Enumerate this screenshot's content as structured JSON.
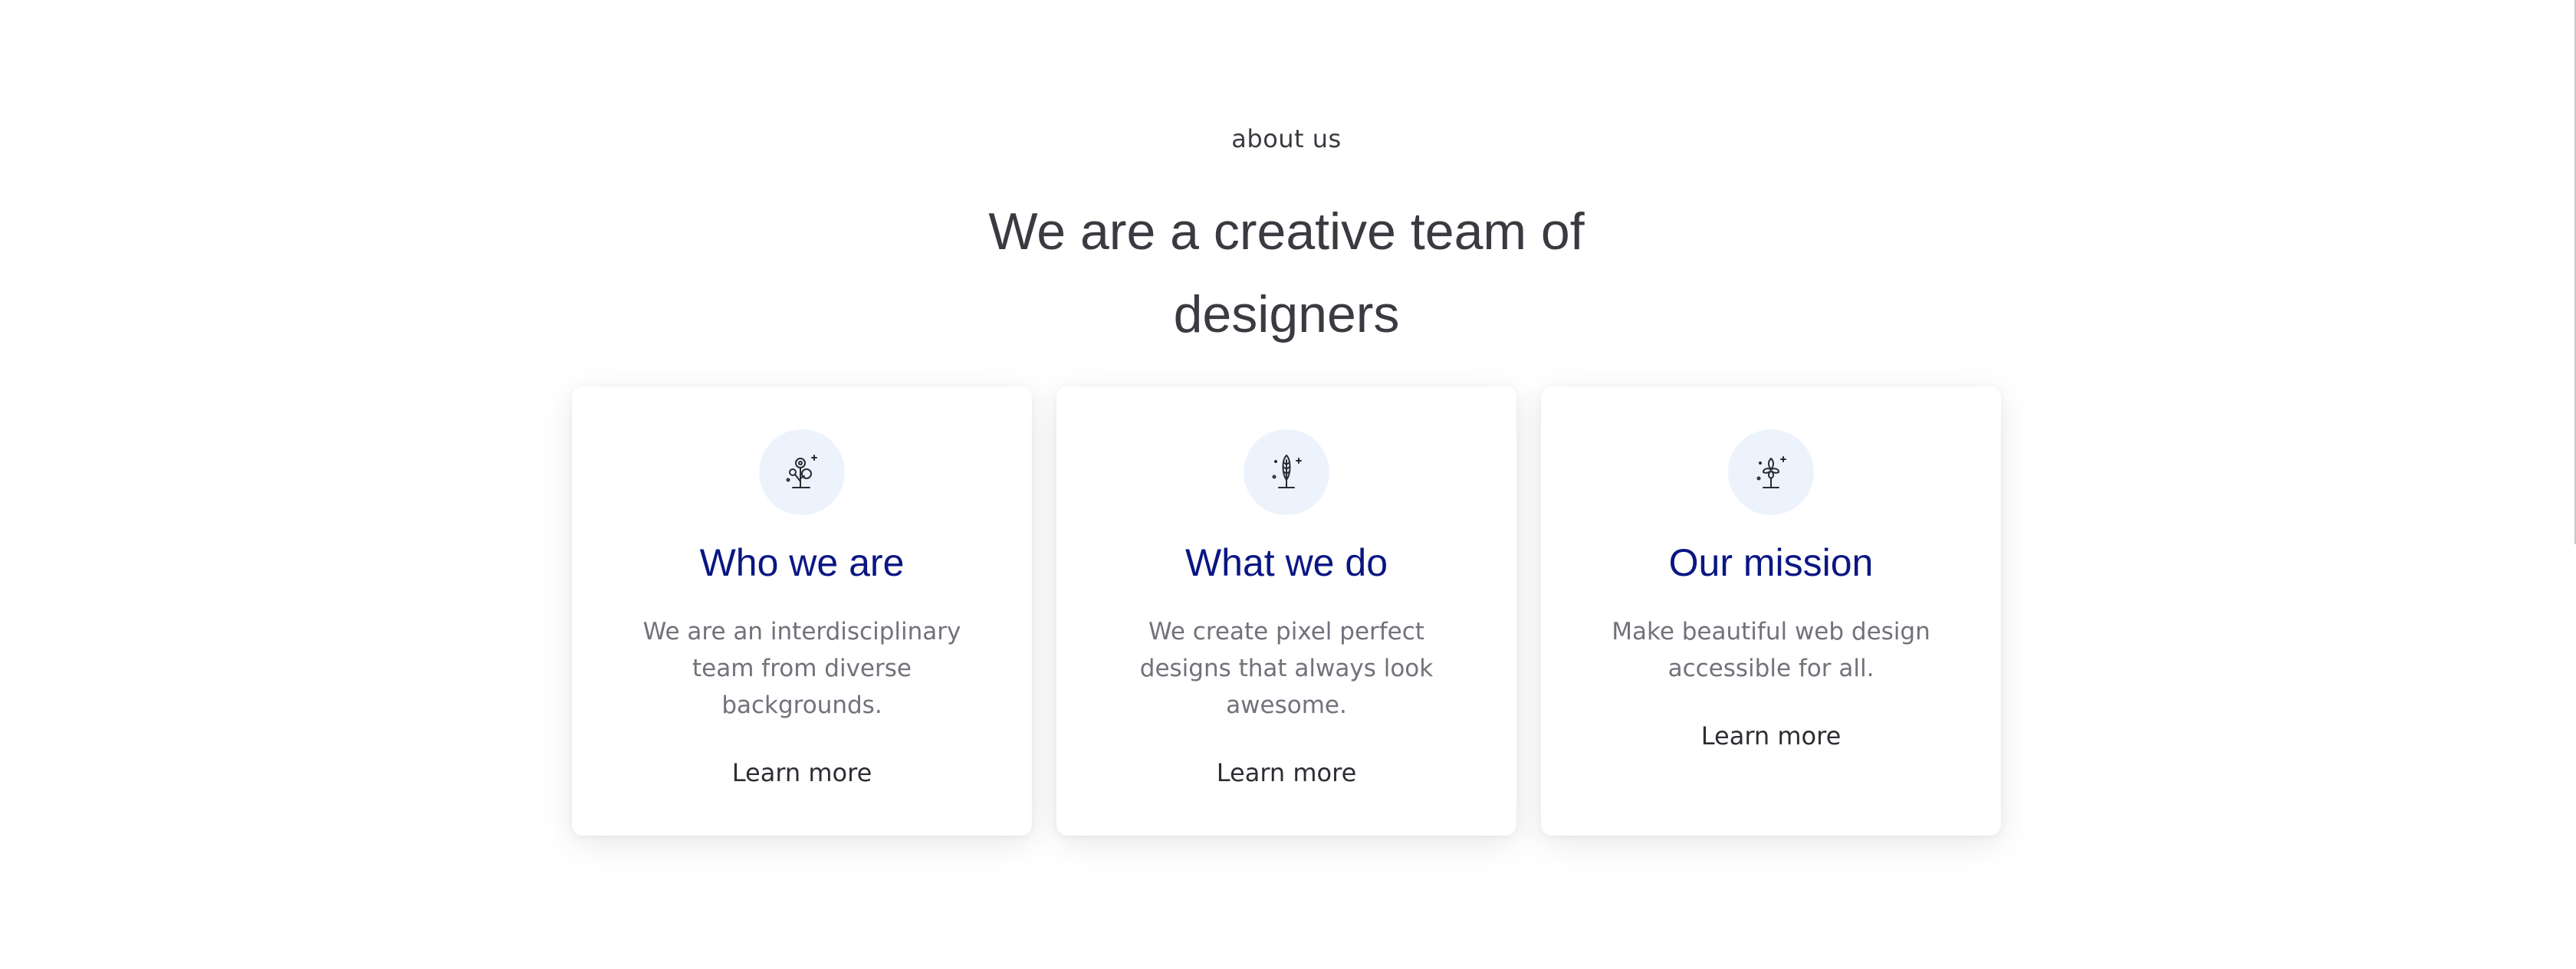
{
  "section": {
    "eyebrow": "about us",
    "headline_line1": "We are a creative team of",
    "headline_line2": "designers"
  },
  "cards": [
    {
      "icon": "flower-tree-icon",
      "title": "Who we are",
      "text": "We are an interdisciplinary team from diverse backgrounds.",
      "link": "Learn more"
    },
    {
      "icon": "leaf-sprout-icon",
      "title": "What we do",
      "text": "We create pixel perfect designs that always look awesome.",
      "link": "Learn more"
    },
    {
      "icon": "plant-growth-icon",
      "title": "Our mission",
      "text": "Make beautiful web design accessible for all.",
      "link": "Learn more"
    }
  ],
  "colors": {
    "heading": "#3a3b41",
    "card_title": "#0a1682",
    "body_text": "#71727a",
    "icon_bg": "#edf3fd"
  }
}
